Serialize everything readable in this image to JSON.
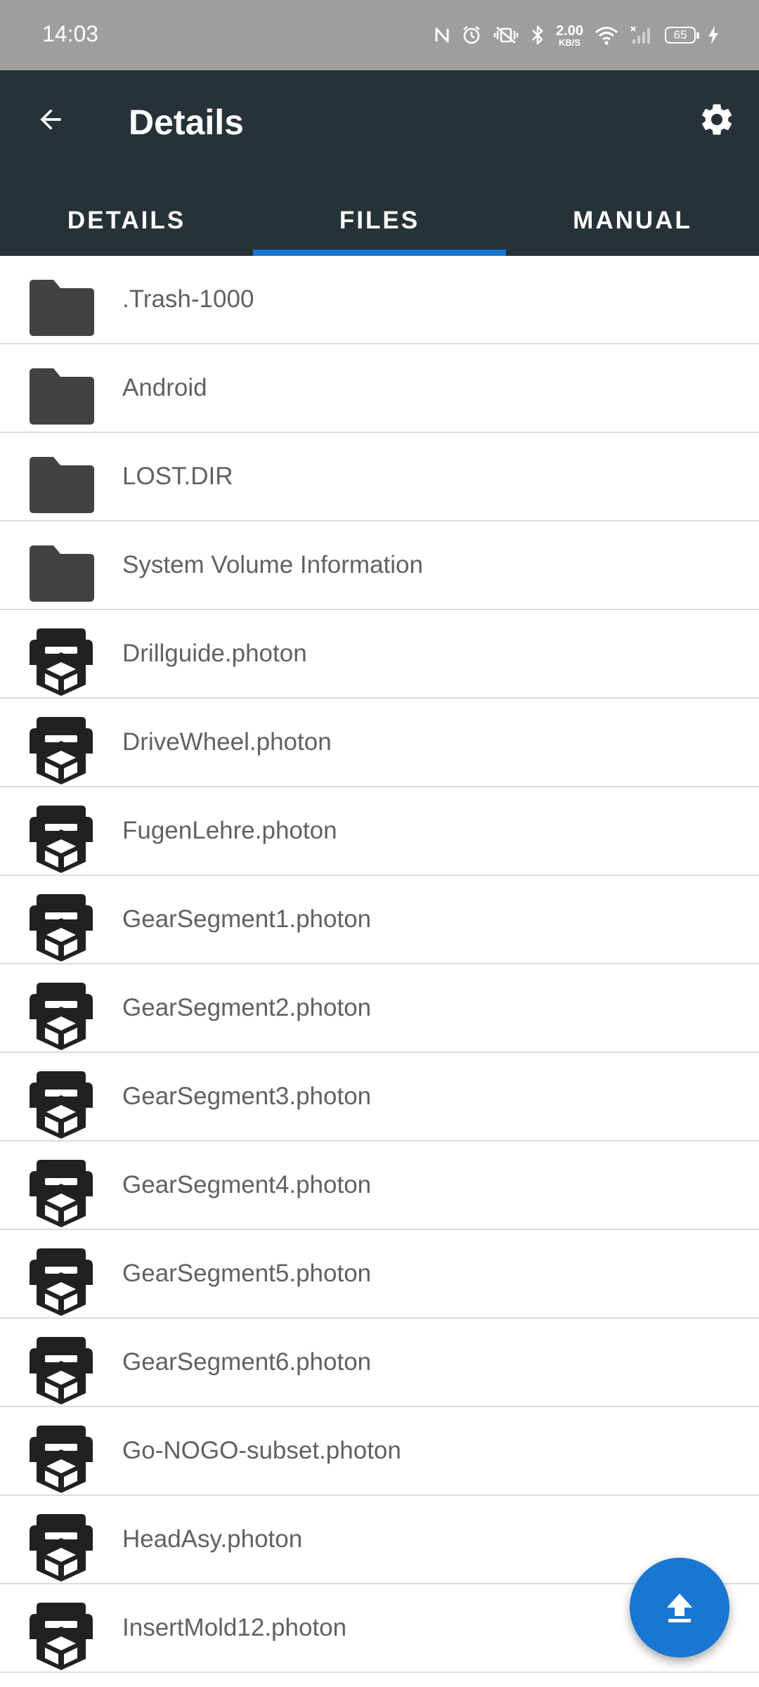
{
  "status_bar": {
    "time": "14:03",
    "net_speed_value": "2.00",
    "net_speed_unit": "KB/S",
    "battery_level": "65",
    "icons": [
      "nfc-icon",
      "alarm-icon",
      "vibrate-icon",
      "bluetooth-icon",
      "wifi-icon",
      "signal-icon",
      "charging-icon"
    ]
  },
  "app_bar": {
    "title": "Details",
    "background": "#263238"
  },
  "tabs": [
    {
      "label": "DETAILS",
      "active": false
    },
    {
      "label": "FILES",
      "active": true
    },
    {
      "label": "MANUAL",
      "active": false
    }
  ],
  "accent": "#1976d2",
  "files": [
    {
      "name": ".Trash-1000",
      "type": "folder-icon"
    },
    {
      "name": "Android",
      "type": "folder-icon"
    },
    {
      "name": "LOST.DIR",
      "type": "folder-icon"
    },
    {
      "name": "System Volume Information",
      "type": "folder-icon"
    },
    {
      "name": "Drillguide.photon",
      "type": "printer-3d-icon"
    },
    {
      "name": "DriveWheel.photon",
      "type": "printer-3d-icon"
    },
    {
      "name": "FugenLehre.photon",
      "type": "printer-3d-icon"
    },
    {
      "name": "GearSegment1.photon",
      "type": "printer-3d-icon"
    },
    {
      "name": "GearSegment2.photon",
      "type": "printer-3d-icon"
    },
    {
      "name": "GearSegment3.photon",
      "type": "printer-3d-icon"
    },
    {
      "name": "GearSegment4.photon",
      "type": "printer-3d-icon"
    },
    {
      "name": "GearSegment5.photon",
      "type": "printer-3d-icon"
    },
    {
      "name": "GearSegment6.photon",
      "type": "printer-3d-icon"
    },
    {
      "name": "Go-NOGO-subset.photon",
      "type": "printer-3d-icon"
    },
    {
      "name": "HeadAsy.photon",
      "type": "printer-3d-icon"
    },
    {
      "name": "InsertMold12.photon",
      "type": "printer-3d-icon"
    },
    {
      "name": "",
      "type": "printer-3d-icon"
    }
  ],
  "fab": {
    "icon": "upload-icon"
  }
}
